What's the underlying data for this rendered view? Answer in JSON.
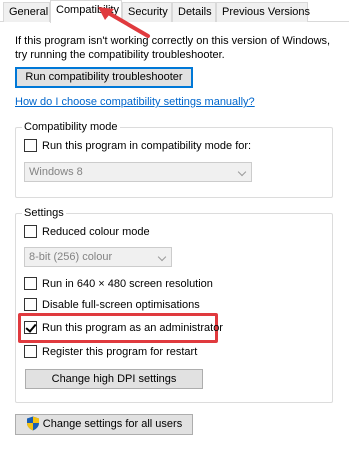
{
  "tabs": [
    {
      "label": "General"
    },
    {
      "label": "Compatibility"
    },
    {
      "label": "Security"
    },
    {
      "label": "Details"
    },
    {
      "label": "Previous Versions"
    }
  ],
  "intro": {
    "line1": "If this program isn't working correctly on this version of Windows,",
    "line2": "try running the compatibility troubleshooter."
  },
  "troubleshoot_button": "Run compatibility troubleshooter",
  "manual_link": "How do I choose compatibility settings manually?",
  "compat_mode": {
    "title": "Compatibility mode",
    "checkbox_label": "Run this program in compatibility mode for:",
    "checked": false,
    "os_select": "Windows 8"
  },
  "settings": {
    "title": "Settings",
    "reduced_colour": {
      "label": "Reduced colour mode",
      "checked": false
    },
    "colour_select": "8-bit (256) colour",
    "run_640": {
      "label": "Run in 640 × 480 screen resolution",
      "checked": false
    },
    "disable_fullscreen": {
      "label": "Disable full-screen optimisations",
      "checked": false
    },
    "run_admin": {
      "label": "Run this program as an administrator",
      "checked": true
    },
    "register_restart": {
      "label": "Register this program for restart",
      "checked": false
    },
    "dpi_button": "Change high DPI settings"
  },
  "all_users_button": "Change settings for all users",
  "colors": {
    "annotation_red": "#e03a3e",
    "link_blue": "#0066cc",
    "focus_blue": "#0078d7"
  }
}
